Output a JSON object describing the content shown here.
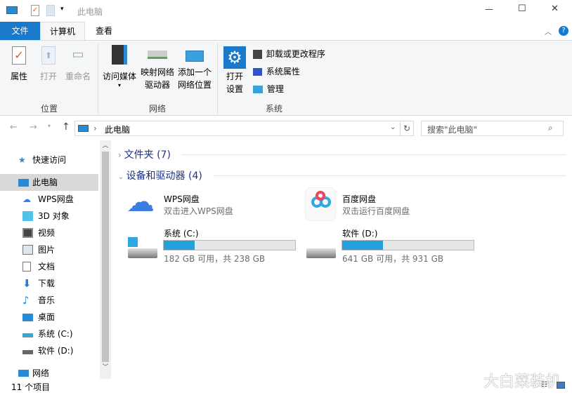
{
  "window": {
    "title": "此电脑",
    "minimize": "—",
    "maximize": "☐",
    "close": "✕"
  },
  "tabs": [
    {
      "label": "文件"
    },
    {
      "label": "计算机"
    },
    {
      "label": "查看"
    }
  ],
  "ribbon": {
    "location": {
      "group": "位置",
      "properties": "属性",
      "open": "打开",
      "rename": "重命名"
    },
    "network": {
      "group": "网络",
      "media": "访问媒体",
      "map_drive": "映射网络",
      "map_drive2": "驱动器",
      "add_location": "添加一个",
      "add_location2": "网络位置"
    },
    "system": {
      "group": "系统",
      "open_settings": "打开",
      "open_settings2": "设置",
      "uninstall": "卸载或更改程序",
      "sys_props": "系统属性",
      "manage": "管理"
    }
  },
  "address": {
    "path": "此电脑",
    "search_placeholder": "搜索\"此电脑\""
  },
  "sidebar": {
    "items": [
      {
        "label": "快速访问"
      },
      {
        "label": "此电脑"
      },
      {
        "label": "WPS网盘"
      },
      {
        "label": "3D 对象"
      },
      {
        "label": "视频"
      },
      {
        "label": "图片"
      },
      {
        "label": "文档"
      },
      {
        "label": "下载"
      },
      {
        "label": "音乐"
      },
      {
        "label": "桌面"
      },
      {
        "label": "系统 (C:)"
      },
      {
        "label": "软件 (D:)"
      },
      {
        "label": "网络"
      }
    ]
  },
  "content": {
    "folders": "文件夹 (7)",
    "devices": "设备和驱动器 (4)",
    "wps": {
      "name": "WPS网盘",
      "sub": "双击进入WPS网盘"
    },
    "baidu": {
      "name": "百度网盘",
      "sub": "双击运行百度网盘"
    },
    "c": {
      "name": "系统 (C:)",
      "info": "182 GB 可用，共 238 GB",
      "used_percent": 23.5
    },
    "d": {
      "name": "软件 (D:)",
      "info": "641 GB 可用，共 931 GB",
      "used_percent": 31.1
    }
  },
  "status": {
    "count": "11 个项目"
  },
  "watermark": "大白菜装机",
  "colors": {
    "accent": "#1979ca",
    "bar": "#26a0da"
  }
}
